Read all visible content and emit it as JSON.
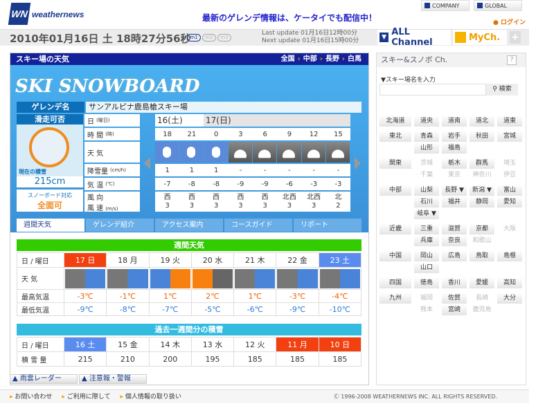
{
  "header": {
    "logo": "WN",
    "brand": "weathernews",
    "promo": "最新のゲレンデ情報は、ケータイでも配信中！",
    "company": "COMPANY",
    "global": "GLOBAL",
    "login": "ログイン"
  },
  "bar": {
    "date": "2010年01月16日 土 18時27分56秒",
    "modes": [
      "m1",
      "m2",
      "m3"
    ],
    "last_update": "Last update  01月16日12時00分",
    "next_update": "Next update  01月16日15時00分",
    "all_channel": "ALL Channel",
    "mych": "MyCh.",
    "plus": "+"
  },
  "panel": {
    "title": "スキー場の天気",
    "crumbs": [
      "全国",
      "中部",
      "長野",
      "白馬"
    ],
    "banner": "SKI SNOWBOARD",
    "gelande_label": "ゲレンデ名",
    "gelande_name": "サンアルピナ鹿島槍スキー場",
    "kahi_label": "滑走可否",
    "now_snow_label": "現在の積雪",
    "now_snow": "215cm",
    "snowboard_label": "スノーボード対応",
    "snowboard_value": "全面可",
    "row_labels": {
      "day": "日",
      "day_unit": "(曜日)",
      "time": "時 間",
      "time_unit": "(時)",
      "weather": "天 気",
      "snowfall": "降雪量",
      "snowfall_unit": "(cm/h)",
      "temp": "気 温",
      "temp_unit": "(℃)",
      "wind_dir": "風 向",
      "wind_speed": "風 速",
      "wind_unit": "(m/s)"
    },
    "days": [
      "16(土)",
      "17(日)"
    ],
    "hours": [
      "18",
      "21",
      "0",
      "3",
      "6",
      "9",
      "12",
      "15"
    ],
    "weather": [
      "snow",
      "snow",
      "snow",
      "cloud",
      "cloud",
      "cloud",
      "cloud",
      "cloud"
    ],
    "snowfall": [
      "1",
      "1",
      "1",
      "-",
      "-",
      "-",
      "-",
      "-"
    ],
    "temps": [
      "-7",
      "-8",
      "-8",
      "-9",
      "-9",
      "-6",
      "-3",
      "-3"
    ],
    "wind_dirs": [
      "西",
      "西",
      "西",
      "西",
      "西",
      "北西",
      "北西",
      "北"
    ],
    "wind_speeds": [
      "3",
      "3",
      "3",
      "3",
      "3",
      "3",
      "3",
      "2"
    ],
    "tabs": [
      "週間天気",
      "ゲレンデ紹介",
      "アクセス案内",
      "コースガイド",
      "リポート"
    ]
  },
  "weekly": {
    "title": "週間天気",
    "date_label": "日 / 曜日",
    "weather_label": "天 気",
    "high_label": "最高気温",
    "low_label": "最低気温",
    "days": [
      {
        "d": "17 日",
        "c": "red"
      },
      {
        "d": "18 月",
        "c": ""
      },
      {
        "d": "19 火",
        "c": ""
      },
      {
        "d": "20 水",
        "c": ""
      },
      {
        "d": "21 木",
        "c": ""
      },
      {
        "d": "22 金",
        "c": ""
      },
      {
        "d": "23 土",
        "c": "blue"
      }
    ],
    "weather": [
      "cloud/snow",
      "cloud>snow",
      "snow>sun",
      "sun/cloud",
      "cloud/snow",
      "cloud/snow",
      "cloud/snow"
    ],
    "high": [
      "-3℃",
      "-1℃",
      "1℃",
      "2℃",
      "1℃",
      "-3℃",
      "-4℃"
    ],
    "low": [
      "-9℃",
      "-8℃",
      "-7℃",
      "-5℃",
      "-6℃",
      "-9℃",
      "-10℃"
    ]
  },
  "snowpast": {
    "title": "過去一週間分の積雪",
    "date_label": "日 / 曜日",
    "amount_label": "積 雪 量",
    "days": [
      {
        "d": "16 土",
        "c": "blue"
      },
      {
        "d": "15 金",
        "c": ""
      },
      {
        "d": "14 木",
        "c": ""
      },
      {
        "d": "13 水",
        "c": ""
      },
      {
        "d": "12 火",
        "c": ""
      },
      {
        "d": "11 月",
        "c": "red"
      },
      {
        "d": "10 日",
        "c": "red"
      }
    ],
    "amounts": [
      "215",
      "210",
      "200",
      "195",
      "185",
      "185",
      "185"
    ]
  },
  "bottom_tabs": [
    "雨雲レーダー",
    "注意報・警報"
  ],
  "footer": {
    "links": [
      "お問い合わせ",
      "ご利用に際して",
      "個人情報の取り扱い"
    ],
    "copyright": "Ⓒ 1996-2008 WEATHERNEWS INC. ALL RIGHTS RESERVED."
  },
  "sidebar": {
    "title": "スキー&スノボ Ch.",
    "help": "?",
    "search_label": "▼スキー場名を入力",
    "search_value": "",
    "search_button": "検索",
    "regions": [
      {
        "label": "北海道",
        "rows": [
          [
            [
              "道央",
              1
            ],
            [
              "道南",
              1
            ],
            [
              "道北",
              1
            ],
            [
              "道東",
              1
            ]
          ]
        ]
      },
      {
        "label": "東北",
        "rows": [
          [
            [
              "青森",
              1
            ],
            [
              "岩手",
              1
            ],
            [
              "秋田",
              1
            ],
            [
              "宮城",
              1
            ]
          ],
          [
            [
              "山形",
              1
            ],
            [
              "福島",
              1
            ]
          ]
        ]
      },
      {
        "label": "関東",
        "rows": [
          [
            [
              "茨城",
              0
            ],
            [
              "栃木",
              1
            ],
            [
              "群馬",
              1
            ],
            [
              "埼玉",
              0
            ]
          ],
          [
            [
              "千葉",
              0
            ],
            [
              "東京",
              0
            ],
            [
              "神奈川",
              0
            ],
            [
              "伊豆",
              0
            ]
          ]
        ]
      },
      {
        "label": "中部",
        "rows": [
          [
            [
              "山梨",
              1
            ],
            [
              "長野 ▼",
              1
            ],
            [
              "新潟 ▼",
              1
            ],
            [
              "富山",
              1
            ]
          ],
          [
            [
              "石川",
              1
            ],
            [
              "福井",
              1
            ],
            [
              "静岡",
              1
            ],
            [
              "愛知",
              1
            ]
          ],
          [
            [
              "岐阜 ▼",
              1
            ]
          ]
        ]
      },
      {
        "label": "近畿",
        "rows": [
          [
            [
              "三重",
              1
            ],
            [
              "滋賀",
              1
            ],
            [
              "京都",
              1
            ],
            [
              "大阪",
              0
            ]
          ],
          [
            [
              "兵庫",
              1
            ],
            [
              "奈良",
              1
            ],
            [
              "和歌山",
              0
            ]
          ]
        ]
      },
      {
        "label": "中国",
        "rows": [
          [
            [
              "岡山",
              1
            ],
            [
              "広島",
              1
            ],
            [
              "鳥取",
              1
            ],
            [
              "島根",
              1
            ]
          ],
          [
            [
              "山口",
              1
            ]
          ]
        ]
      },
      {
        "label": "四国",
        "rows": [
          [
            [
              "徳島",
              1
            ],
            [
              "香川",
              1
            ],
            [
              "愛媛",
              1
            ],
            [
              "高知",
              1
            ]
          ]
        ]
      },
      {
        "label": "九州",
        "rows": [
          [
            [
              "福岡",
              0
            ],
            [
              "佐賀",
              1
            ],
            [
              "長崎",
              0
            ],
            [
              "大分",
              1
            ]
          ],
          [
            [
              "熊本",
              0
            ],
            [
              "宮崎",
              1
            ],
            [
              "鹿児島",
              0
            ]
          ]
        ]
      }
    ]
  }
}
